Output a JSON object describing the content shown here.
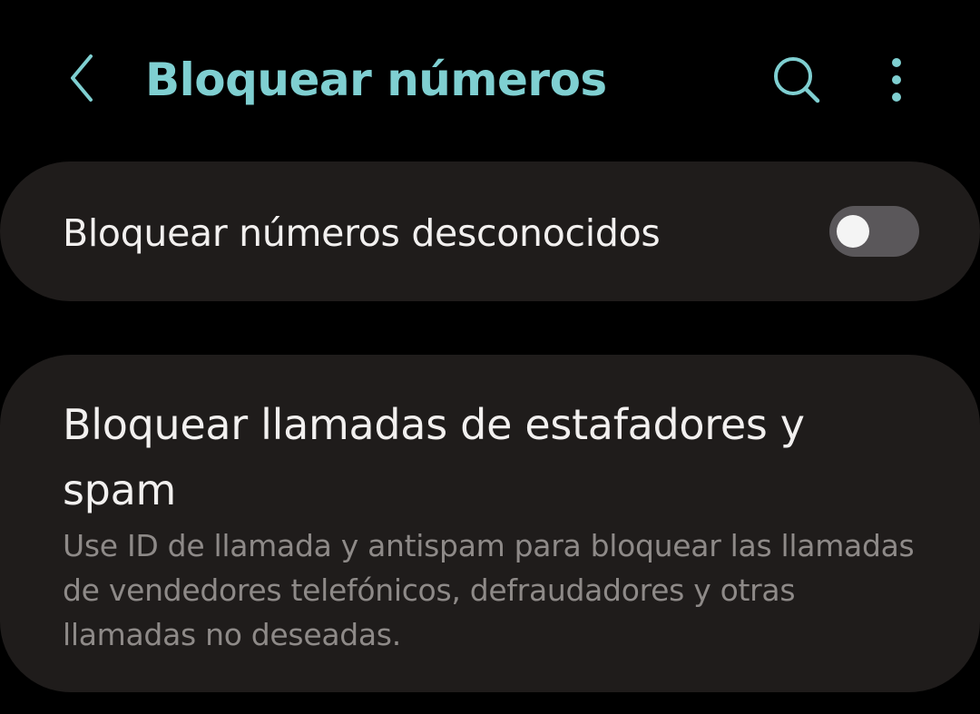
{
  "colors": {
    "background": "#000000",
    "card": "#1f1c1b",
    "accent": "#7fcfd1",
    "primary_text": "#f2f0ef",
    "secondary_text": "#8e8a88",
    "toggle_track": "#5a575a",
    "toggle_knob": "#f4f4f4"
  },
  "header": {
    "back_icon": "chevron-left-icon",
    "title": "Bloquear números",
    "search_icon": "search-icon",
    "more_icon": "more-vertical-icon"
  },
  "settings": {
    "block_unknown": {
      "label": "Bloquear números desconocidos",
      "enabled": false
    },
    "block_spam": {
      "title": "Bloquear llamadas de estafadores y spam",
      "description": "Use ID de llamada y antispam para bloquear las llamadas de vendedores telefónicos, defraudadores y otras llamadas no deseadas."
    }
  }
}
